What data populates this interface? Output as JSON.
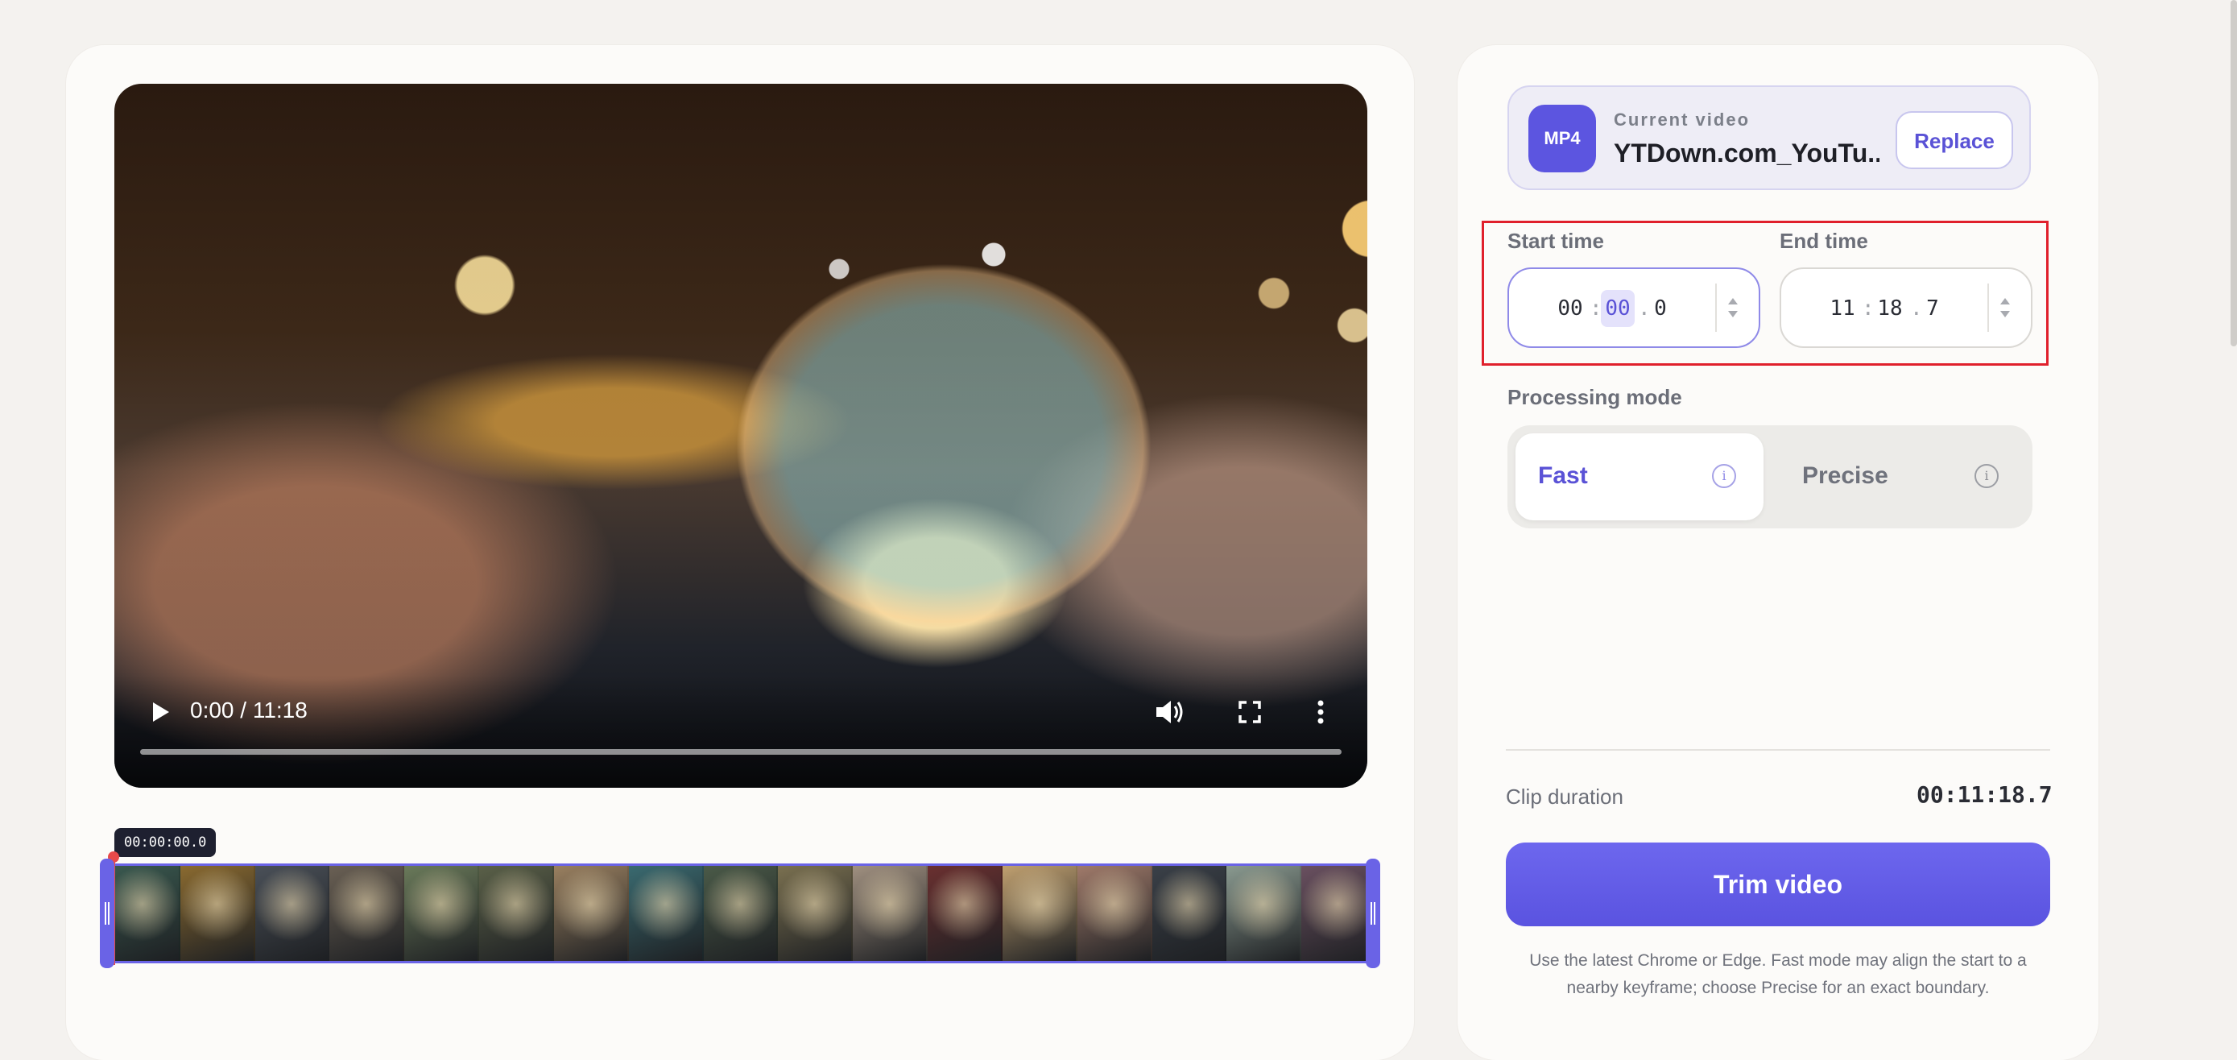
{
  "video": {
    "time_readout": "0:00 / 11:18",
    "progress": 0
  },
  "timeline": {
    "timestamp": "00:00:00.0",
    "frame_count": 17,
    "frame_colors": [
      "#3a5a50",
      "#8a6a30",
      "#4a5058",
      "#6a6054",
      "#6a7a5a",
      "#5a6048",
      "#9a8060",
      "#3a6a70",
      "#4a5a48",
      "#7a7050",
      "#a09080",
      "#6a3030",
      "#c0a070",
      "#a07a6a",
      "#3a4048",
      "#8a9a90",
      "#6a5060"
    ]
  },
  "current_video": {
    "badge": "MP4",
    "label": "Current video",
    "file_name": "YTDown.com_YouTu...",
    "replace_label": "Replace"
  },
  "start_time": {
    "label": "Start time",
    "minutes": "00",
    "seconds": "00",
    "tenths": "0"
  },
  "end_time": {
    "label": "End time",
    "minutes": "11",
    "seconds": "18",
    "tenths": "7"
  },
  "processing_mode": {
    "label": "Processing mode",
    "options": [
      "Fast",
      "Precise"
    ],
    "selected": "Fast"
  },
  "clip": {
    "label": "Clip duration",
    "value": "00:11:18.7"
  },
  "trim_label": "Trim video",
  "hint": "Use the latest Chrome or Edge. Fast mode may align the start to a nearby keyframe; choose Precise for an exact boundary.",
  "colors": {
    "accent": "#5c55e0",
    "highlight_border": "#e0202c",
    "playhead": "#e84a4a"
  }
}
